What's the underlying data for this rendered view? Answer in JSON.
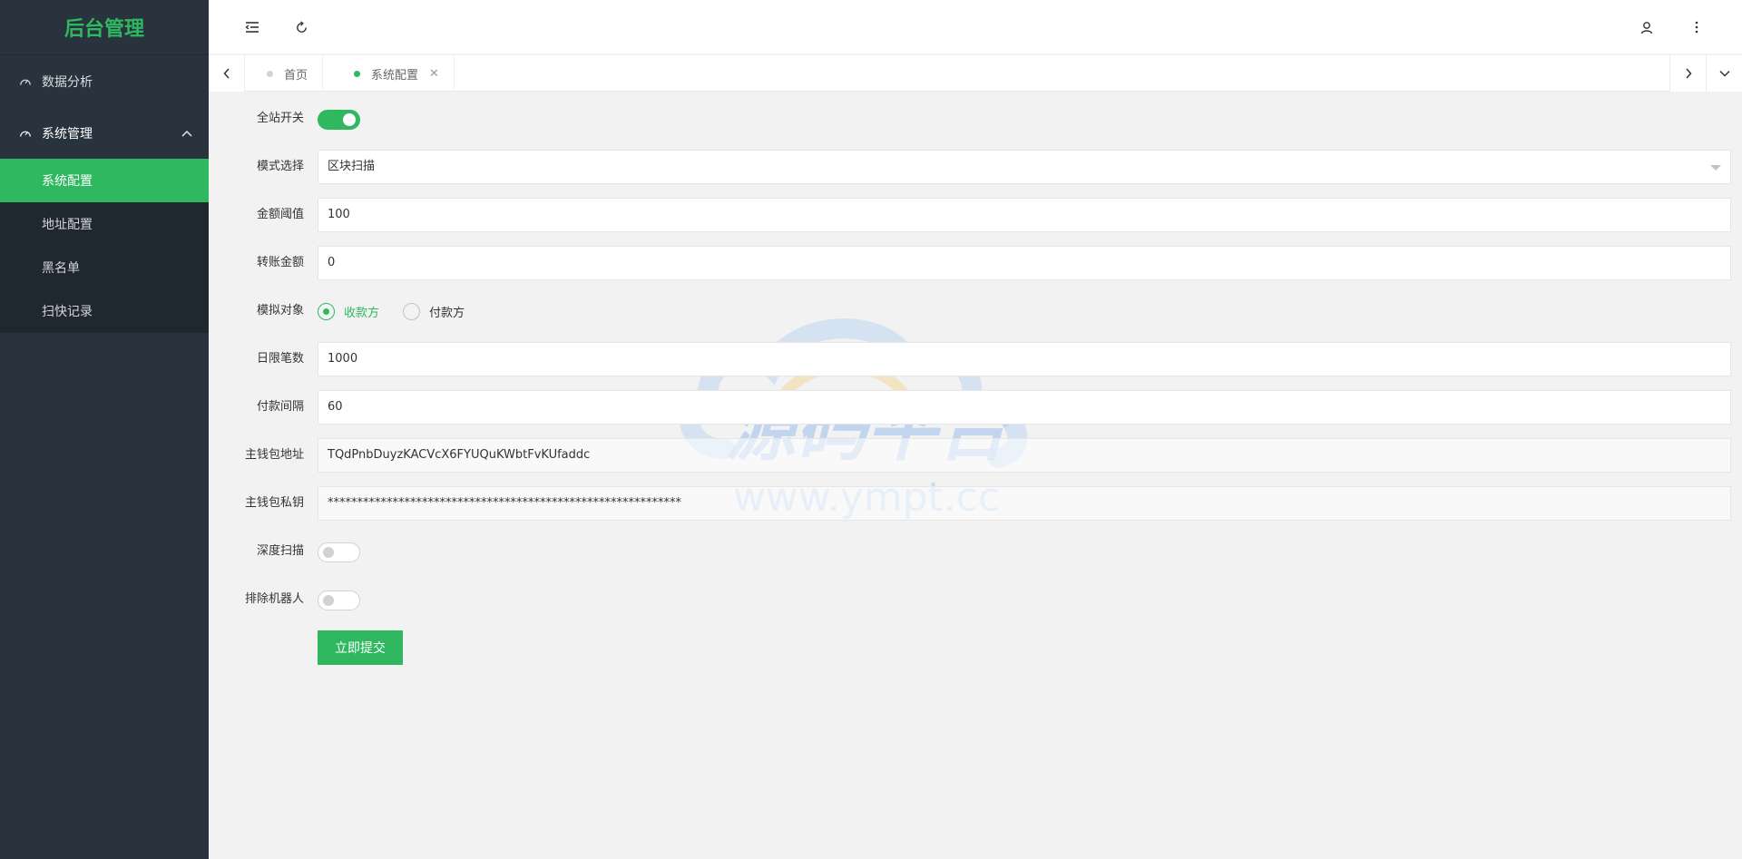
{
  "app": {
    "title": "后台管理"
  },
  "sidebar": {
    "items": [
      {
        "label": "数据分析",
        "icon": "dashboard-icon"
      },
      {
        "label": "系统管理",
        "icon": "dashboard-icon",
        "expanded": true,
        "children": [
          {
            "label": "系统配置",
            "active": true
          },
          {
            "label": "地址配置"
          },
          {
            "label": "黑名单"
          },
          {
            "label": "扫快记录"
          }
        ]
      }
    ]
  },
  "header": {
    "menu_icon": "indent-icon",
    "refresh_icon": "refresh-icon",
    "user_icon": "user-icon",
    "more_icon": "more-vertical-icon"
  },
  "tabs": [
    {
      "label": "首页"
    },
    {
      "label": "系统配置",
      "active": true,
      "close": "✕"
    }
  ],
  "form": {
    "site_switch": {
      "label": "全站开关",
      "on": true
    },
    "mode": {
      "label": "模式选择",
      "value": "区块扫描"
    },
    "amount_threshold": {
      "label": "金额阈值",
      "value": "100"
    },
    "transfer_amount": {
      "label": "转账金额",
      "value": "0"
    },
    "target": {
      "label": "模拟对象",
      "options": [
        "收款方",
        "付款方"
      ],
      "selected": "收款方"
    },
    "daily_limit": {
      "label": "日限笔数",
      "value": "1000"
    },
    "pay_interval": {
      "label": "付款间隔",
      "value": "60"
    },
    "wallet_address": {
      "label": "主钱包地址",
      "value": "TQdPnbDuyzKACVcX6FYUQuKWbtFvKUfaddc"
    },
    "wallet_key": {
      "label": "主钱包私钥",
      "value": "************************************************************"
    },
    "deep_scan": {
      "label": "深度扫描",
      "on": false
    },
    "exclude_robot": {
      "label": "排除机器人",
      "on": false
    },
    "submit_label": "立即提交"
  },
  "watermark": {
    "text_cn": "源码平台",
    "text_url": "www.ympt.cc"
  },
  "colors": {
    "accent": "#2fb85f",
    "sidebar_bg": "#28333e",
    "sidebar_sub_bg": "#1f2730"
  }
}
